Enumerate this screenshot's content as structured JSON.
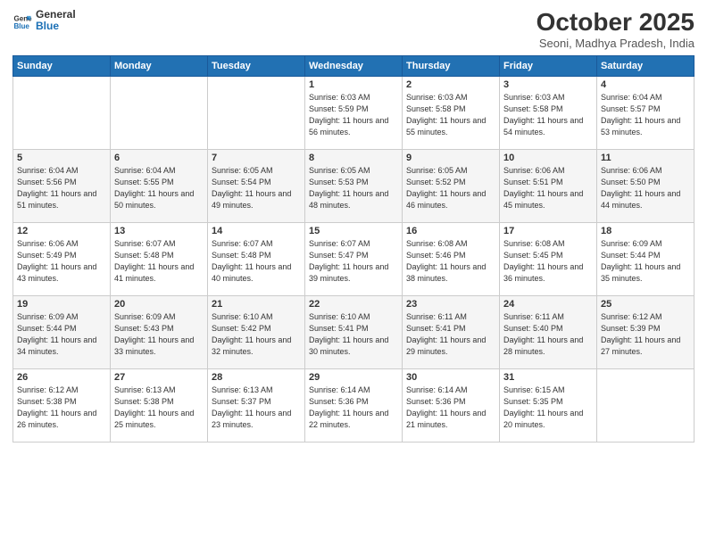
{
  "header": {
    "logo_line1": "General",
    "logo_line2": "Blue",
    "month_title": "October 2025",
    "subtitle": "Seoni, Madhya Pradesh, India"
  },
  "weekdays": [
    "Sunday",
    "Monday",
    "Tuesday",
    "Wednesday",
    "Thursday",
    "Friday",
    "Saturday"
  ],
  "rows": [
    [
      {
        "day": "",
        "sunrise": "",
        "sunset": "",
        "daylight": ""
      },
      {
        "day": "",
        "sunrise": "",
        "sunset": "",
        "daylight": ""
      },
      {
        "day": "",
        "sunrise": "",
        "sunset": "",
        "daylight": ""
      },
      {
        "day": "1",
        "sunrise": "Sunrise: 6:03 AM",
        "sunset": "Sunset: 5:59 PM",
        "daylight": "Daylight: 11 hours and 56 minutes."
      },
      {
        "day": "2",
        "sunrise": "Sunrise: 6:03 AM",
        "sunset": "Sunset: 5:58 PM",
        "daylight": "Daylight: 11 hours and 55 minutes."
      },
      {
        "day": "3",
        "sunrise": "Sunrise: 6:03 AM",
        "sunset": "Sunset: 5:58 PM",
        "daylight": "Daylight: 11 hours and 54 minutes."
      },
      {
        "day": "4",
        "sunrise": "Sunrise: 6:04 AM",
        "sunset": "Sunset: 5:57 PM",
        "daylight": "Daylight: 11 hours and 53 minutes."
      }
    ],
    [
      {
        "day": "5",
        "sunrise": "Sunrise: 6:04 AM",
        "sunset": "Sunset: 5:56 PM",
        "daylight": "Daylight: 11 hours and 51 minutes."
      },
      {
        "day": "6",
        "sunrise": "Sunrise: 6:04 AM",
        "sunset": "Sunset: 5:55 PM",
        "daylight": "Daylight: 11 hours and 50 minutes."
      },
      {
        "day": "7",
        "sunrise": "Sunrise: 6:05 AM",
        "sunset": "Sunset: 5:54 PM",
        "daylight": "Daylight: 11 hours and 49 minutes."
      },
      {
        "day": "8",
        "sunrise": "Sunrise: 6:05 AM",
        "sunset": "Sunset: 5:53 PM",
        "daylight": "Daylight: 11 hours and 48 minutes."
      },
      {
        "day": "9",
        "sunrise": "Sunrise: 6:05 AM",
        "sunset": "Sunset: 5:52 PM",
        "daylight": "Daylight: 11 hours and 46 minutes."
      },
      {
        "day": "10",
        "sunrise": "Sunrise: 6:06 AM",
        "sunset": "Sunset: 5:51 PM",
        "daylight": "Daylight: 11 hours and 45 minutes."
      },
      {
        "day": "11",
        "sunrise": "Sunrise: 6:06 AM",
        "sunset": "Sunset: 5:50 PM",
        "daylight": "Daylight: 11 hours and 44 minutes."
      }
    ],
    [
      {
        "day": "12",
        "sunrise": "Sunrise: 6:06 AM",
        "sunset": "Sunset: 5:49 PM",
        "daylight": "Daylight: 11 hours and 43 minutes."
      },
      {
        "day": "13",
        "sunrise": "Sunrise: 6:07 AM",
        "sunset": "Sunset: 5:48 PM",
        "daylight": "Daylight: 11 hours and 41 minutes."
      },
      {
        "day": "14",
        "sunrise": "Sunrise: 6:07 AM",
        "sunset": "Sunset: 5:48 PM",
        "daylight": "Daylight: 11 hours and 40 minutes."
      },
      {
        "day": "15",
        "sunrise": "Sunrise: 6:07 AM",
        "sunset": "Sunset: 5:47 PM",
        "daylight": "Daylight: 11 hours and 39 minutes."
      },
      {
        "day": "16",
        "sunrise": "Sunrise: 6:08 AM",
        "sunset": "Sunset: 5:46 PM",
        "daylight": "Daylight: 11 hours and 38 minutes."
      },
      {
        "day": "17",
        "sunrise": "Sunrise: 6:08 AM",
        "sunset": "Sunset: 5:45 PM",
        "daylight": "Daylight: 11 hours and 36 minutes."
      },
      {
        "day": "18",
        "sunrise": "Sunrise: 6:09 AM",
        "sunset": "Sunset: 5:44 PM",
        "daylight": "Daylight: 11 hours and 35 minutes."
      }
    ],
    [
      {
        "day": "19",
        "sunrise": "Sunrise: 6:09 AM",
        "sunset": "Sunset: 5:44 PM",
        "daylight": "Daylight: 11 hours and 34 minutes."
      },
      {
        "day": "20",
        "sunrise": "Sunrise: 6:09 AM",
        "sunset": "Sunset: 5:43 PM",
        "daylight": "Daylight: 11 hours and 33 minutes."
      },
      {
        "day": "21",
        "sunrise": "Sunrise: 6:10 AM",
        "sunset": "Sunset: 5:42 PM",
        "daylight": "Daylight: 11 hours and 32 minutes."
      },
      {
        "day": "22",
        "sunrise": "Sunrise: 6:10 AM",
        "sunset": "Sunset: 5:41 PM",
        "daylight": "Daylight: 11 hours and 30 minutes."
      },
      {
        "day": "23",
        "sunrise": "Sunrise: 6:11 AM",
        "sunset": "Sunset: 5:41 PM",
        "daylight": "Daylight: 11 hours and 29 minutes."
      },
      {
        "day": "24",
        "sunrise": "Sunrise: 6:11 AM",
        "sunset": "Sunset: 5:40 PM",
        "daylight": "Daylight: 11 hours and 28 minutes."
      },
      {
        "day": "25",
        "sunrise": "Sunrise: 6:12 AM",
        "sunset": "Sunset: 5:39 PM",
        "daylight": "Daylight: 11 hours and 27 minutes."
      }
    ],
    [
      {
        "day": "26",
        "sunrise": "Sunrise: 6:12 AM",
        "sunset": "Sunset: 5:38 PM",
        "daylight": "Daylight: 11 hours and 26 minutes."
      },
      {
        "day": "27",
        "sunrise": "Sunrise: 6:13 AM",
        "sunset": "Sunset: 5:38 PM",
        "daylight": "Daylight: 11 hours and 25 minutes."
      },
      {
        "day": "28",
        "sunrise": "Sunrise: 6:13 AM",
        "sunset": "Sunset: 5:37 PM",
        "daylight": "Daylight: 11 hours and 23 minutes."
      },
      {
        "day": "29",
        "sunrise": "Sunrise: 6:14 AM",
        "sunset": "Sunset: 5:36 PM",
        "daylight": "Daylight: 11 hours and 22 minutes."
      },
      {
        "day": "30",
        "sunrise": "Sunrise: 6:14 AM",
        "sunset": "Sunset: 5:36 PM",
        "daylight": "Daylight: 11 hours and 21 minutes."
      },
      {
        "day": "31",
        "sunrise": "Sunrise: 6:15 AM",
        "sunset": "Sunset: 5:35 PM",
        "daylight": "Daylight: 11 hours and 20 minutes."
      },
      {
        "day": "",
        "sunrise": "",
        "sunset": "",
        "daylight": ""
      }
    ]
  ]
}
